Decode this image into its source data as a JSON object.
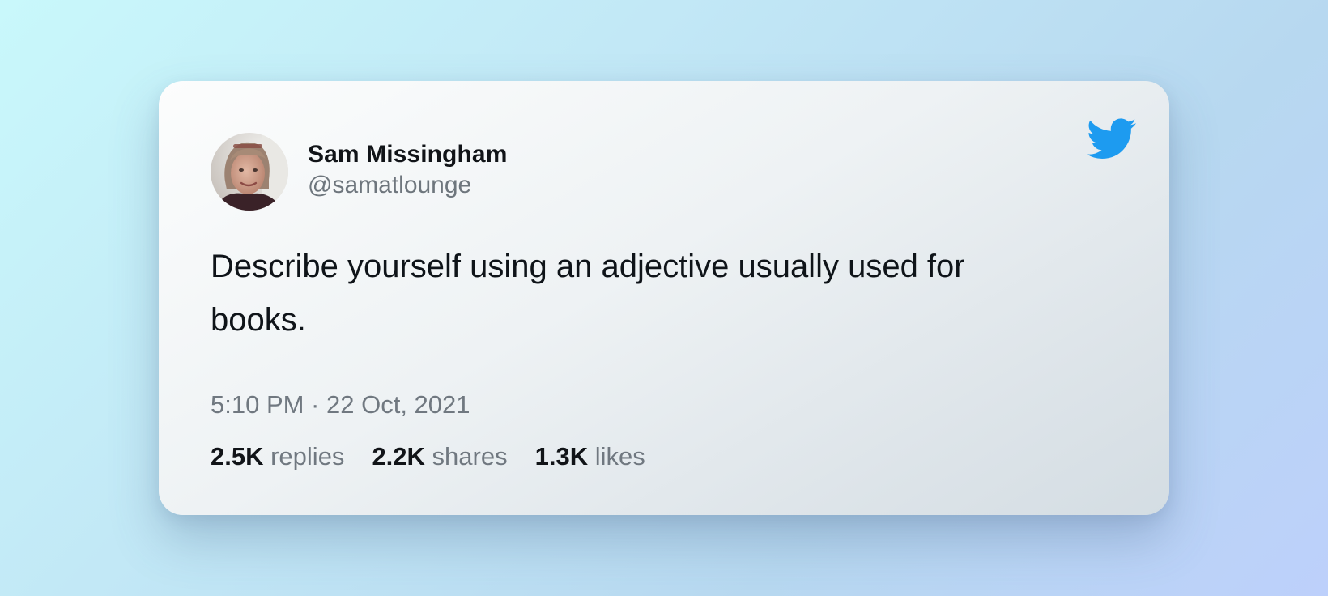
{
  "tweet": {
    "author_name": "Sam Missingham",
    "author_handle": "@samatlounge",
    "text": "Describe yourself using an adjective usually used for books.",
    "timestamp": "5:10 PM · 22 Oct, 2021",
    "stats": [
      {
        "count": "2.5K",
        "label": "replies"
      },
      {
        "count": "2.2K",
        "label": "shares"
      },
      {
        "count": "1.3K",
        "label": "likes"
      }
    ]
  },
  "icons": {
    "brand": "twitter-bird-icon",
    "brand_color": "#1d9bf0"
  },
  "colors": {
    "text_primary": "#0f1419",
    "text_secondary": "#6e767d"
  }
}
